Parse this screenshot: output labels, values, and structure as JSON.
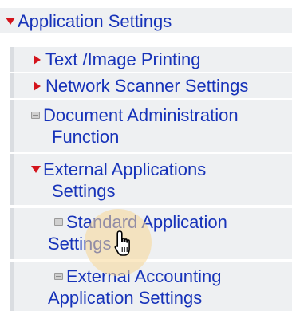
{
  "menu": {
    "application_settings": {
      "label": "Application Settings",
      "expanded": true
    },
    "text_image_printing": {
      "label": "Text /Image Printing"
    },
    "network_scanner_settings": {
      "label": "Network Scanner Settings"
    },
    "document_admin": {
      "line1": "Document Administration",
      "line2": "Function"
    },
    "external_apps": {
      "line1": "External Applications",
      "line2": "Settings",
      "expanded": true
    },
    "standard_app": {
      "line1": "Standard Application",
      "line2": "Settings"
    },
    "external_accounting": {
      "line1": "External Accounting",
      "line2": "Application Settings"
    }
  },
  "colors": {
    "link": "#1733b9",
    "arrow": "#d4141c",
    "row_background": "#eef0f2",
    "indent_bar": "#dadde1"
  },
  "icons": {
    "expand": "triangle-down-icon",
    "collapsed": "triangle-right-icon",
    "page": "page-icon",
    "cursor": "hand-pointer-cursor"
  }
}
